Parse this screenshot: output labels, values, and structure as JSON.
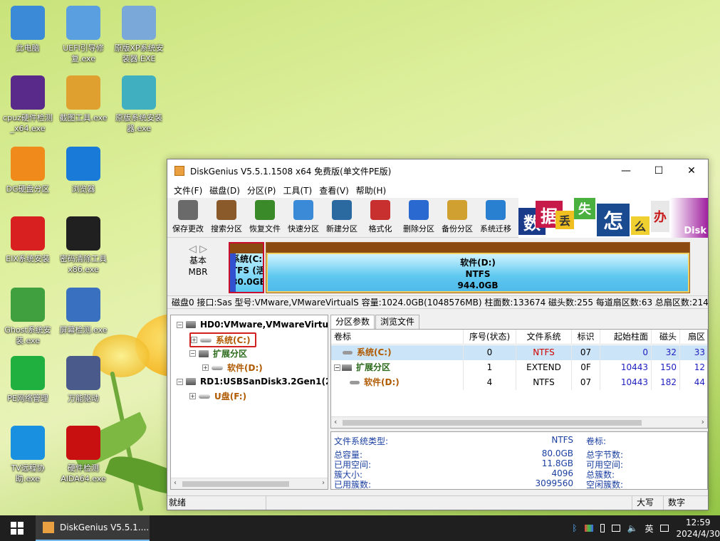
{
  "desktop": {
    "icons": [
      {
        "label": "此电脑",
        "color": "#3a8ad8"
      },
      {
        "label": "UEFI引导修复.exe",
        "color": "#5aa0e0"
      },
      {
        "label": "原版XP系统安装器.EXE",
        "color": "#7aa8d8"
      },
      {
        "label": "cpuz硬件检测_x64.exe",
        "color": "#5a2a8a"
      },
      {
        "label": "截图工具.exe",
        "color": "#e0a030"
      },
      {
        "label": "原版系统安装器.exe",
        "color": "#40b0c0"
      },
      {
        "label": "DG硬盘分区",
        "color": "#f08a1a"
      },
      {
        "label": "浏览器",
        "color": "#1a7ad8"
      },
      {
        "label": "EIX系统安装",
        "color": "#d82020"
      },
      {
        "label": "密码清除工具x86.exe",
        "color": "#202020"
      },
      {
        "label": "Ghost系统安装.exe",
        "color": "#40a040"
      },
      {
        "label": "屏幕检测.exe",
        "color": "#3a70c0"
      },
      {
        "label": "PE网络管理",
        "color": "#20b040"
      },
      {
        "label": "万能驱动",
        "color": "#4a5a8a"
      },
      {
        "label": "TV远程协助.exe",
        "color": "#1a90e0"
      },
      {
        "label": "硬件检测AIDA64.exe",
        "color": "#c81010"
      }
    ]
  },
  "window": {
    "title": "DiskGenius V5.5.1.1508 x64 免费版(单文件PE版)",
    "controls": {
      "minimize": "—",
      "maximize": "☐",
      "close": "✕"
    },
    "menu": [
      "文件(F)",
      "磁盘(D)",
      "分区(P)",
      "工具(T)",
      "查看(V)",
      "帮助(H)"
    ],
    "toolbar": [
      {
        "label": "保存更改",
        "color": "#6a6a6a"
      },
      {
        "label": "搜索分区",
        "color": "#8a5a2a"
      },
      {
        "label": "恢复文件",
        "color": "#3a8a2a"
      },
      {
        "label": "快速分区",
        "color": "#3a8ad8"
      },
      {
        "label": "新建分区",
        "color": "#2a6aa0"
      },
      {
        "label": "格式化",
        "color": "#c83030"
      },
      {
        "label": "删除分区",
        "color": "#2a6ad0"
      },
      {
        "label": "备份分区",
        "color": "#d0a030"
      },
      {
        "label": "系统迁移",
        "color": "#2a80d0"
      }
    ],
    "banner": {
      "chars": [
        "数",
        "据",
        "丢",
        "失",
        "怎",
        "么",
        "办"
      ],
      "tail": "Disk"
    },
    "diskmap": {
      "arrows": "◁ ▷",
      "basic": "基本",
      "mbr": "MBR",
      "p1": {
        "name": "系统(C:",
        "fs": "TFS (活",
        "size": "80.0GB"
      },
      "p2": {
        "name": "软件(D:)",
        "fs": "NTFS",
        "size": "944.0GB"
      }
    },
    "diskinfo": "磁盘0 接口:Sas  型号:VMware,VMwareVirtualS  容量:1024.0GB(1048576MB)  柱面数:133674  磁头数:255  每道扇区数:63  总扇区数:214",
    "tree": {
      "nodes": [
        {
          "label": "HD0:VMware,VMwareVirtu",
          "level": 0
        },
        {
          "label": "系统(C:)",
          "level": 1
        },
        {
          "label": "扩展分区",
          "level": 1
        },
        {
          "label": "软件(D:)",
          "level": 2
        },
        {
          "label": "RD1:USBSanDisk3.2Gen1(2",
          "level": 0
        },
        {
          "label": "U盘(F:)",
          "level": 1
        }
      ]
    },
    "tabs": [
      "分区参数",
      "浏览文件"
    ],
    "grid": {
      "columns": [
        "卷标",
        "序号(状态)",
        "文件系统",
        "标识",
        "起始柱面",
        "磁头",
        "扇区"
      ],
      "rows": [
        {
          "name": "系统(C:)",
          "num": "0",
          "fs": "NTFS",
          "id": "07",
          "cyl": "0",
          "head": "32",
          "sec": "33"
        },
        {
          "name": "扩展分区",
          "num": "1",
          "fs": "EXTEND",
          "id": "0F",
          "cyl": "10443",
          "head": "150",
          "sec": "12"
        },
        {
          "name": "软件(D:)",
          "num": "4",
          "fs": "NTFS",
          "id": "07",
          "cyl": "10443",
          "head": "182",
          "sec": "44"
        }
      ]
    },
    "info": {
      "fstype_label": "文件系统类型:",
      "fstype_value": "NTFS",
      "volume_label": "卷标:",
      "rows": [
        {
          "label": "总容量:",
          "value": "80.0GB",
          "right": "总字节数:"
        },
        {
          "label": "已用空间:",
          "value": "11.8GB",
          "right": "可用空间:"
        },
        {
          "label": "簇大小:",
          "value": "4096",
          "right": "总簇数:"
        },
        {
          "label": "已用簇数:",
          "value": "3099560",
          "right": "空闲簇数:"
        }
      ]
    },
    "status": {
      "ready": "就绪",
      "caps": "大写",
      "num": "数字"
    }
  },
  "taskbar": {
    "app_label": "DiskGenius V5.5.1....",
    "tray": {
      "bluetooth": "ᛒ",
      "ime": "英",
      "time": "12:59",
      "date": "2024/4/30"
    }
  }
}
